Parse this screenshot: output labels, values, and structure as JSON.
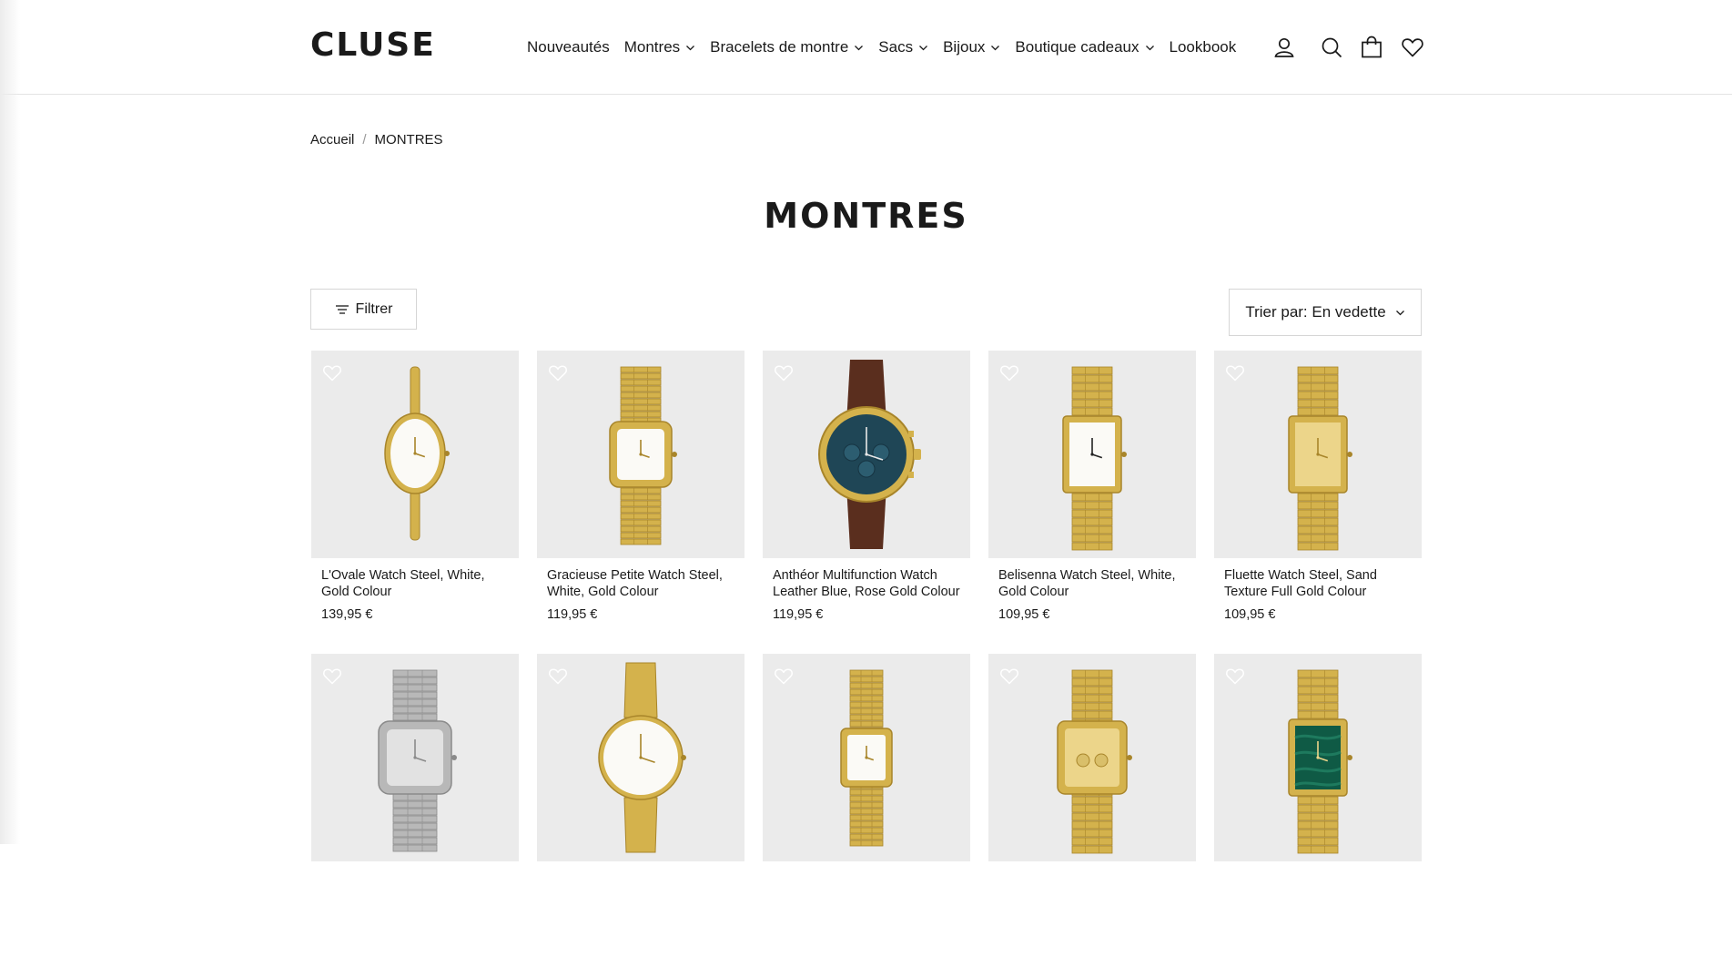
{
  "header": {
    "logo": "CLUSE",
    "nav": [
      {
        "label": "Nouveautés",
        "dropdown": false
      },
      {
        "label": "Montres",
        "dropdown": true
      },
      {
        "label": "Bracelets de montre",
        "dropdown": true
      },
      {
        "label": "Sacs",
        "dropdown": true
      },
      {
        "label": "Bijoux",
        "dropdown": true
      },
      {
        "label": "Boutique cadeaux",
        "dropdown": true
      },
      {
        "label": "Lookbook",
        "dropdown": false
      }
    ],
    "icons": [
      "account-icon",
      "search-icon",
      "cart-icon",
      "wishlist-icon"
    ]
  },
  "breadcrumb": {
    "home": "Accueil",
    "separator": "/",
    "current": "MONTRES"
  },
  "page_title": "MONTRES",
  "controls": {
    "filter_label": "Filtrer",
    "sort_label": "Trier par: En vedette"
  },
  "colors": {
    "text": "#1a1a1a",
    "tile_bg": "#ebebeb",
    "border": "#d6d6d6",
    "gold": "#d4b24c",
    "silver": "#b8b8b8"
  },
  "products": [
    {
      "name": "L'Ovale Watch Steel, White, Gold Colour",
      "price": "139,95 €",
      "style": "oval"
    },
    {
      "name": "Gracieuse Petite Watch Steel, White, Gold Colour",
      "price": "119,95 €",
      "style": "square-gold"
    },
    {
      "name": "Anthéor Multifunction Watch Leather Blue, Rose Gold Colour",
      "price": "119,95 €",
      "style": "chrono-blue"
    },
    {
      "name": "Belisenna Watch Steel, White, Gold Colour",
      "price": "109,95 €",
      "style": "rect-roman"
    },
    {
      "name": "Fluette Watch Steel, Sand Texture Full Gold Colour",
      "price": "109,95 €",
      "style": "rect-sand"
    },
    {
      "name": "",
      "price": "",
      "style": "square-silver"
    },
    {
      "name": "",
      "price": "",
      "style": "round-mesh"
    },
    {
      "name": "",
      "price": "",
      "style": "square-small"
    },
    {
      "name": "",
      "price": "",
      "style": "square-multi"
    },
    {
      "name": "",
      "price": "",
      "style": "rect-green"
    }
  ]
}
